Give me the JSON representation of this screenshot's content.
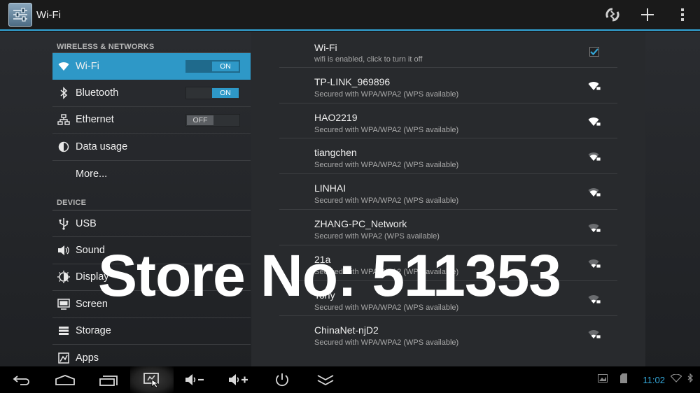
{
  "actionbar": {
    "title": "Wi-Fi",
    "icons": [
      "settings-sliders-icon",
      "wps-refresh-icon",
      "add-icon",
      "overflow-menu-icon"
    ]
  },
  "sidebar": {
    "section1": "WIRELESS & NETWORKS",
    "section2": "DEVICE",
    "items": [
      {
        "label": "Wi-Fi",
        "icon": "wifi-icon",
        "toggle": "ON"
      },
      {
        "label": "Bluetooth",
        "icon": "bluetooth-icon",
        "toggle": "ON"
      },
      {
        "label": "Ethernet",
        "icon": "ethernet-icon",
        "toggle": "OFF"
      },
      {
        "label": "Data usage",
        "icon": "data-usage-icon"
      },
      {
        "label": "More...",
        "icon": ""
      },
      {
        "label": "USB",
        "icon": "usb-icon"
      },
      {
        "label": "Sound",
        "icon": "sound-icon"
      },
      {
        "label": "Display",
        "icon": "display-icon"
      },
      {
        "label": "Screen",
        "icon": "screen-icon"
      },
      {
        "label": "Storage",
        "icon": "storage-icon"
      },
      {
        "label": "Apps",
        "icon": "apps-icon"
      }
    ]
  },
  "wifi": {
    "header_title": "Wi-Fi",
    "header_sub": "wifi is enabled, click to turn it off",
    "networks": [
      {
        "name": "TP-LINK_969896",
        "security": "Secured with WPA/WPA2 (WPS available)"
      },
      {
        "name": "HAO2219",
        "security": "Secured with WPA/WPA2 (WPS available)"
      },
      {
        "name": "tiangchen",
        "security": "Secured with WPA/WPA2 (WPS available)"
      },
      {
        "name": "LINHAI",
        "security": "Secured with WPA/WPA2 (WPS available)"
      },
      {
        "name": "ZHANG-PC_Network",
        "security": "Secured with WPA2 (WPS available)"
      },
      {
        "name": "21a",
        "security": "Secured with WPA/WPA2 (WPS available)"
      },
      {
        "name": "Tony",
        "security": "Secured with WPA/WPA2 (WPS available)"
      },
      {
        "name": "ChinaNet-njD2",
        "security": "Secured with WPA/WPA2 (WPS available)"
      }
    ]
  },
  "watermark": "Store No: 511353",
  "sysbar": {
    "clock": "11:02",
    "accent": "#33a5d6"
  },
  "colors": {
    "accent": "#33a5d6",
    "selected": "#2e98c7"
  }
}
